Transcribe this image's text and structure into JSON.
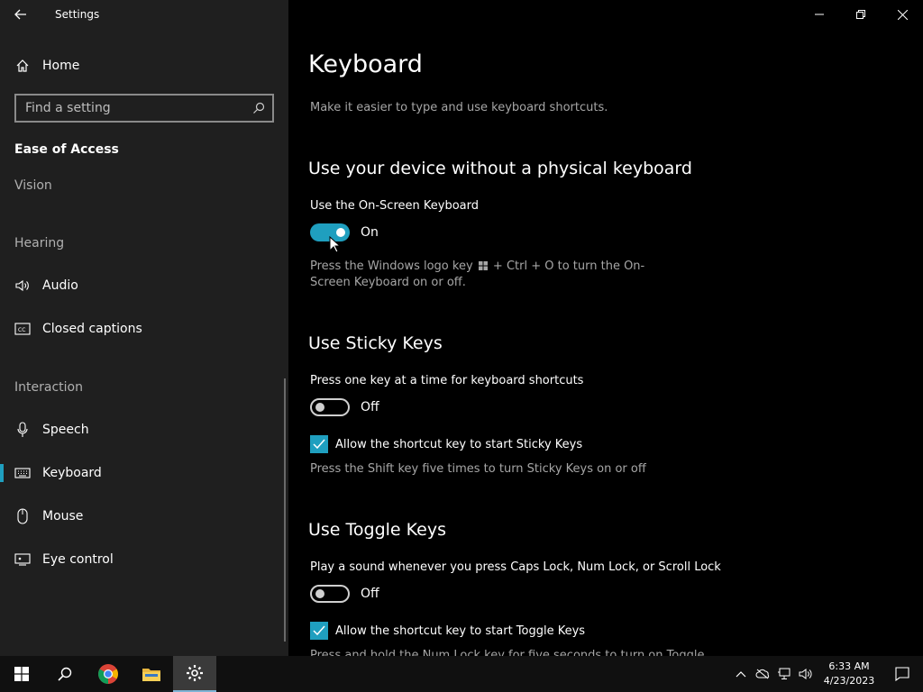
{
  "window": {
    "title": "Settings"
  },
  "sidebar": {
    "home_label": "Home",
    "search_placeholder": "Find a setting",
    "group_title": "Ease of Access",
    "sections": {
      "vision": "Vision",
      "hearing": "Hearing",
      "interaction": "Interaction"
    },
    "items": [
      {
        "label": "Audio",
        "icon": "speaker-icon"
      },
      {
        "label": "Closed captions",
        "icon": "cc-icon"
      },
      {
        "label": "Speech",
        "icon": "microphone-icon"
      },
      {
        "label": "Keyboard",
        "icon": "keyboard-icon",
        "active": true
      },
      {
        "label": "Mouse",
        "icon": "mouse-icon"
      },
      {
        "label": "Eye control",
        "icon": "eye-control-icon"
      }
    ]
  },
  "main": {
    "title": "Keyboard",
    "description": "Make it easier to type and use keyboard shortcuts.",
    "osk": {
      "heading": "Use your device without a physical keyboard",
      "label": "Use the On-Screen Keyboard",
      "state": "On",
      "hint_prefix": "Press the Windows logo key",
      "hint_suffix": "+ Ctrl + O to turn the On-Screen Keyboard on or off."
    },
    "sticky": {
      "heading": "Use Sticky Keys",
      "label": "Press one key at a time for keyboard shortcuts",
      "state": "Off",
      "checkbox_label": "Allow the shortcut key to start Sticky Keys",
      "hint": "Press the Shift key five times to turn Sticky Keys on or off"
    },
    "toggle_keys": {
      "heading": "Use Toggle Keys",
      "label": "Play a sound whenever you press Caps Lock, Num Lock, or Scroll Lock",
      "state": "Off",
      "checkbox_label": "Allow the shortcut key to start Toggle Keys",
      "hint": "Press and hold the Num Lock key for five seconds to turn on Toggle"
    }
  },
  "taskbar": {
    "time": "6:33 AM",
    "date": "4/23/2023"
  },
  "colors": {
    "accent": "#1f9fbf",
    "sidebar_bg": "#1f1f1f",
    "main_bg": "#000000"
  }
}
